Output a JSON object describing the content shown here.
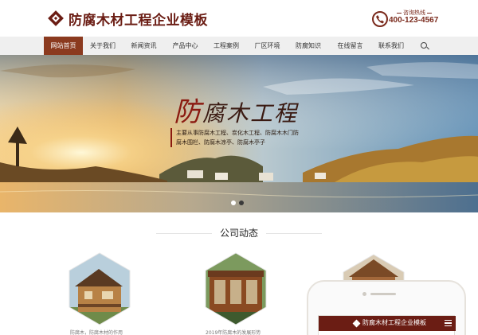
{
  "header": {
    "site_title": "防腐木材工程企业模板",
    "hotline_label": "咨询热线",
    "hotline_number": "400-123-4567",
    "icons": {
      "logo": "diamond-logo-icon",
      "hotline": "phone-icon"
    }
  },
  "nav": {
    "items": [
      {
        "label": "网站首页",
        "active": true
      },
      {
        "label": "关于我们",
        "active": false
      },
      {
        "label": "新闻资讯",
        "active": false
      },
      {
        "label": "产品中心",
        "active": false
      },
      {
        "label": "工程案例",
        "active": false
      },
      {
        "label": "厂区环境",
        "active": false
      },
      {
        "label": "防腐知识",
        "active": false
      },
      {
        "label": "在线留言",
        "active": false
      },
      {
        "label": "联系我们",
        "active": false
      }
    ],
    "search_icon": "search-icon"
  },
  "banner": {
    "title_first": "防",
    "title_rest": "腐木工程",
    "description": "主要从事防腐木工程、炭化木工程、防腐木木门防腐木围栏、防腐木凉亭、防腐木亭子",
    "slides_total": 2,
    "active_slide": 2
  },
  "news_section": {
    "title": "公司动态",
    "items": [
      {
        "caption": "防腐木，防腐木材的作用"
      },
      {
        "caption": "2019年防腐木的发展形势"
      },
      {
        "caption": ""
      }
    ]
  },
  "phone_preview": {
    "title": "防腐木材工程企业模板",
    "icons": {
      "menu": "hamburger-menu-icon"
    }
  },
  "colors": {
    "brand": "#6b1d14",
    "nav_active": "#8b3a1f",
    "nav_bg": "#efefef"
  }
}
